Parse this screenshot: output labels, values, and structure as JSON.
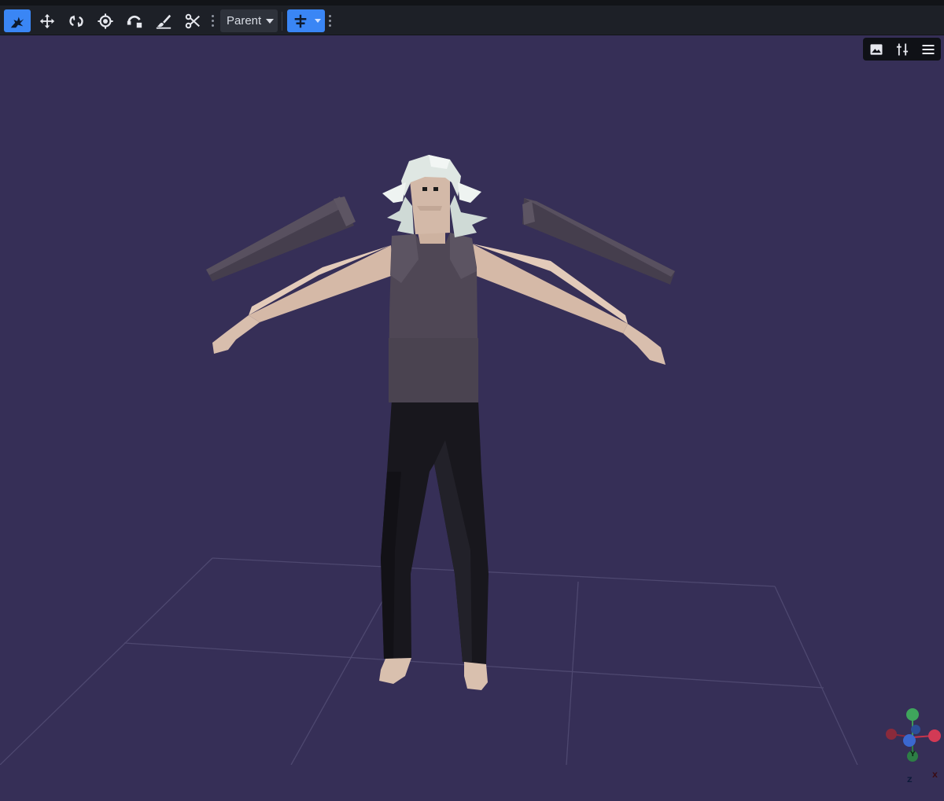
{
  "toolbar": {
    "tools": [
      {
        "name": "select-tool",
        "icon": "cursor-leaf-icon",
        "active": true
      },
      {
        "name": "move-tool",
        "icon": "move-arrows-icon",
        "active": false
      },
      {
        "name": "rotate-tool",
        "icon": "rotate-icon",
        "active": false
      },
      {
        "name": "pivot-tool",
        "icon": "pivot-target-icon",
        "active": false
      },
      {
        "name": "bend-tool",
        "icon": "bend-arc-icon",
        "active": false
      },
      {
        "name": "paint-tool",
        "icon": "brush-icon",
        "active": false
      },
      {
        "name": "cut-tool",
        "icon": "scissors-icon",
        "active": false
      }
    ],
    "transform_space": {
      "selected": "Parent"
    },
    "snap_button": {
      "icon": "snap-plus-icon",
      "active": true
    }
  },
  "viewport": {
    "background": "#362f57",
    "panel_tools": [
      {
        "name": "image-icon"
      },
      {
        "name": "sliders-icon"
      },
      {
        "name": "menu-icon"
      }
    ],
    "gizmo": {
      "x": "X",
      "y": "Y",
      "z": "Z"
    }
  },
  "colors": {
    "accent": "#3a86f5",
    "toolbar_bg": "#1d2027",
    "skin": "#d9c0ae",
    "shirt": "#4e4654",
    "pants": "#17161c",
    "hair": "#d9e3df",
    "wings": "#433c4b"
  }
}
